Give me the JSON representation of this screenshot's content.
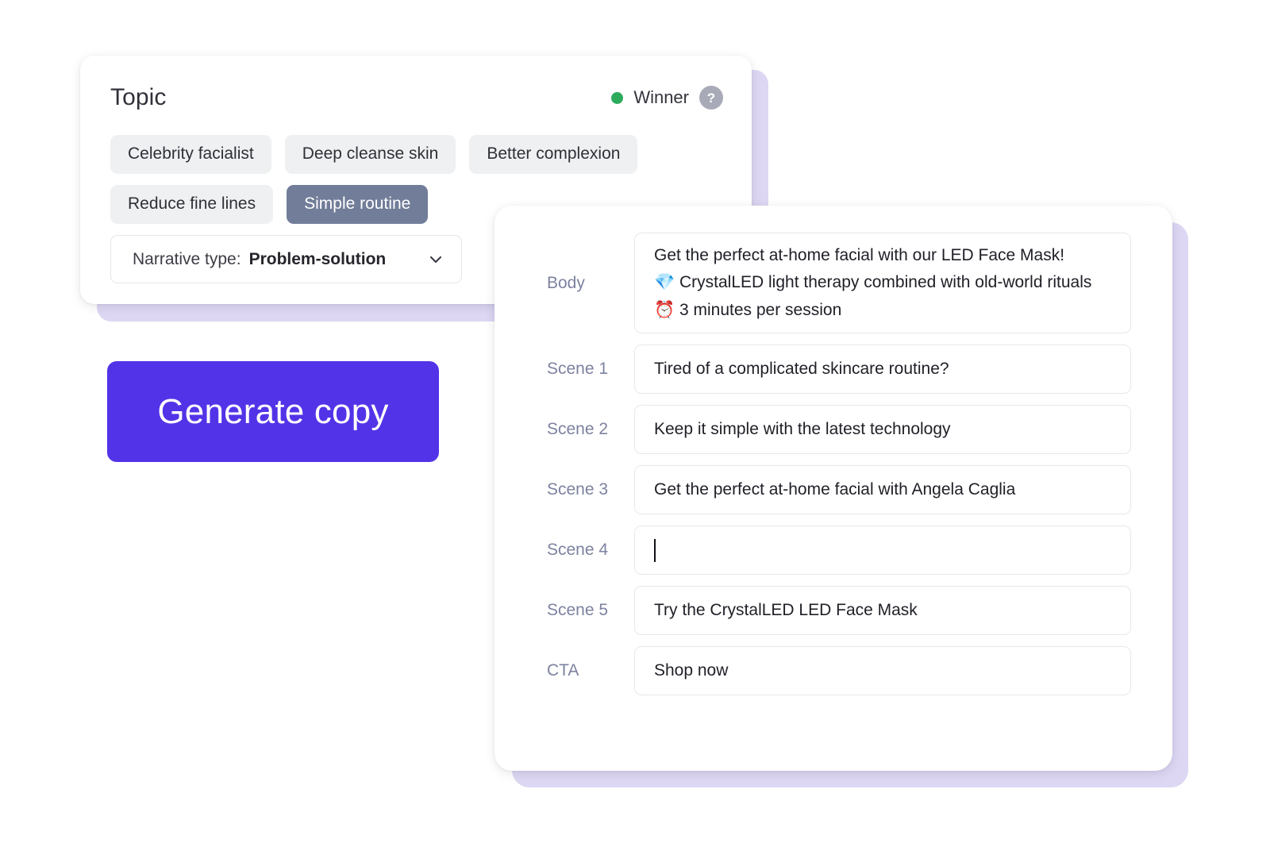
{
  "topic_card": {
    "title": "Topic",
    "status": {
      "label": "Winner",
      "dot_color": "#2cab5d",
      "help_glyph": "?"
    },
    "chips": [
      {
        "label": "Celebrity facialist",
        "selected": false
      },
      {
        "label": "Deep cleanse skin",
        "selected": false
      },
      {
        "label": "Better complexion",
        "selected": false
      },
      {
        "label": "Reduce fine lines",
        "selected": false
      },
      {
        "label": "Simple routine",
        "selected": true
      }
    ],
    "narrative": {
      "label": "Narrative type:",
      "value": "Problem-solution"
    }
  },
  "generate_button": {
    "label": "Generate copy",
    "color": "#5333e8"
  },
  "copy_card": {
    "rows": [
      {
        "label": "Body",
        "lines": [
          "Get the perfect at-home facial with our LED Face Mask!",
          "💎 CrystalLED light therapy combined with old-world rituals",
          "⏰ 3 minutes per session"
        ]
      },
      {
        "label": "Scene 1",
        "value": "Tired of a complicated skincare routine?"
      },
      {
        "label": "Scene 2",
        "value": "Keep it simple with the latest technology"
      },
      {
        "label": "Scene 3",
        "value": "Get the perfect at-home facial with Angela Caglia"
      },
      {
        "label": "Scene 4",
        "value": ""
      },
      {
        "label": "Scene 5",
        "value": "Try the CrystalLED LED Face Mask"
      },
      {
        "label": "CTA",
        "value": "Shop now"
      }
    ]
  },
  "theme": {
    "accent": "#5333e8",
    "offset_layer": "#ddd7f3",
    "chip_bg": "#eff0f1",
    "chip_selected_bg": "#727d99",
    "label_color": "#7d82a0"
  }
}
